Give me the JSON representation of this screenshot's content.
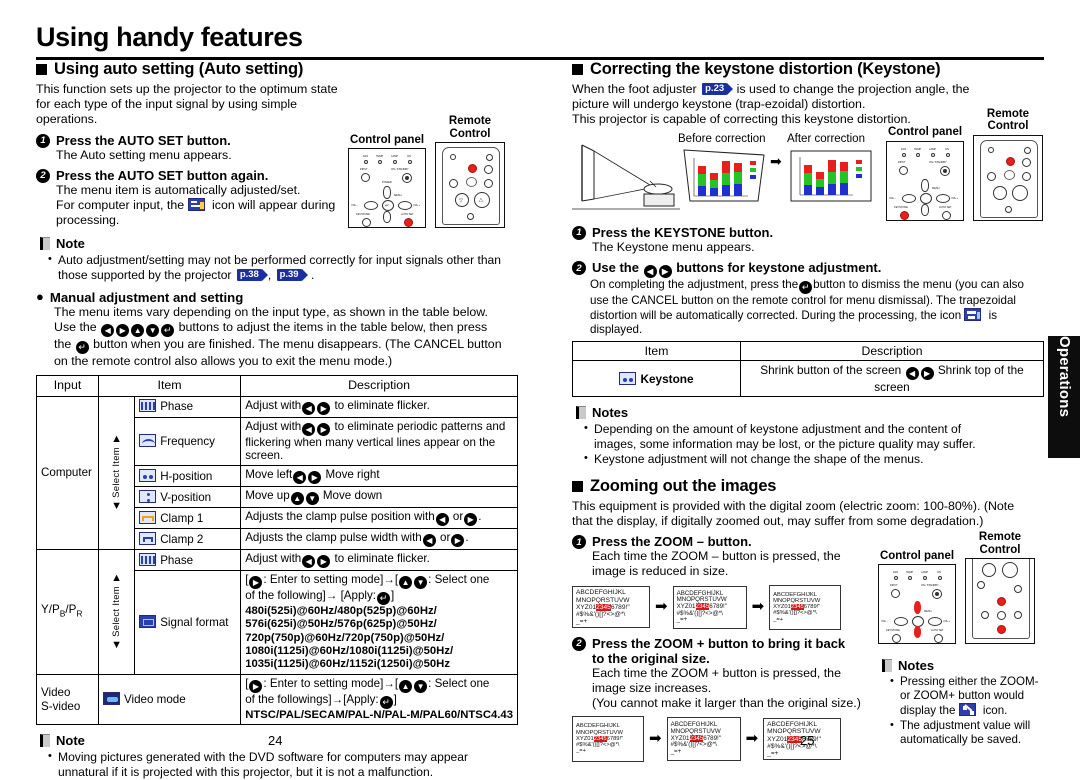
{
  "chapter": {
    "title": "Using handy features"
  },
  "page_numbers": {
    "left": "24",
    "right": "25"
  },
  "side_tab": {
    "label": "Operations"
  },
  "auto_setting": {
    "heading": "Using auto setting (Auto setting)",
    "intro": "This function sets up the projector to the optimum state for each type of the input signal by using simple operations.",
    "step1_title": "Press the AUTO SET button.",
    "step1_sub": "The Auto setting menu appears.",
    "step2_title": "Press the AUTO SET button again.",
    "step2_sub_a": "The menu item is automatically adjusted/set.",
    "step2_sub_b1": "For computer input, the",
    "step2_sub_b2": "icon will appear during",
    "step2_sub_c": "processing.",
    "note_heading": "Note",
    "note_text_a": "Auto adjustment/setting may not be performed correctly for input signals other than those supported by the projector",
    "note_ref1": "p.38",
    "note_ref2": "p.39",
    "devices": {
      "control_panel": "Control panel",
      "remote_l1": "Remote",
      "remote_l2": "Control"
    }
  },
  "manual": {
    "bullet_heading": "Manual adjustment and setting",
    "line1": "The menu items vary depending on the input type, as shown in the table below.",
    "line2_a": "Use the",
    "line2_b": "buttons to adjust the items in the table below, then press",
    "line3_a": "the",
    "line3_b": "button when you are finished. The menu disappears. (The CANCEL button",
    "line4": "on the remote control also allows you to exit the menu mode.)"
  },
  "menu_table": {
    "headers": [
      "Input",
      "Item",
      "Description"
    ],
    "select_item_label": "Select Item",
    "groups": [
      {
        "input": "Computer",
        "rows": [
          {
            "icon": "phase-icon",
            "item": "Phase",
            "desc_pre": "Adjust with",
            "desc_post": "to eliminate flicker.",
            "btns": [
              "left",
              "right"
            ]
          },
          {
            "icon": "frequency-icon",
            "item": "Frequency",
            "desc_pre": "Adjust with",
            "desc_post": "to eliminate periodic patterns and flickering when many vertical lines appear on the screen.",
            "btns": [
              "left",
              "right"
            ]
          },
          {
            "icon": "hposition-icon",
            "item": "H-position",
            "desc_pre": "Move left",
            "desc_post": "Move right",
            "btns": [
              "left",
              "right"
            ]
          },
          {
            "icon": "vposition-icon",
            "item": "V-position",
            "desc_pre": "Move up",
            "desc_post": "Move down",
            "btns": [
              "up",
              "down"
            ]
          },
          {
            "icon": "clamp1-icon",
            "item": "Clamp 1",
            "desc_pre": "Adjusts the clamp pulse position with",
            "desc_mid": "or",
            "desc_post": ".",
            "btns": [
              "left",
              "right"
            ]
          },
          {
            "icon": "clamp2-icon",
            "item": "Clamp 2",
            "desc_pre": "Adjusts the clamp pulse width with",
            "desc_mid": "or",
            "desc_post": ".",
            "btns": [
              "left",
              "right"
            ]
          }
        ]
      },
      {
        "input": "Y/PB/PR",
        "rows": [
          {
            "icon": "phase-icon",
            "item": "Phase",
            "desc_pre": "Adjust with",
            "desc_post": "to eliminate flicker.",
            "btns": [
              "left",
              "right"
            ]
          },
          {
            "icon": "signal-icon",
            "item": "Signal format",
            "mode_a": ": Enter to setting mode]",
            "mode_b": ": Select one",
            "mode_c": "of the following]",
            "mode_d": "[Apply:",
            "formats": [
              "480i(525i)@60Hz/480p(525p)@60Hz/",
              "576i(625i)@50Hz/576p(625p)@50Hz/",
              "720p(750p)@60Hz/720p(750p)@50Hz/",
              "1080i(1125i)@60Hz/1080i(1125i)@50Hz/",
              "1035i(1125i)@60Hz/1152i(1250i)@50Hz"
            ]
          }
        ]
      },
      {
        "input": "Video\nS-video",
        "input_l1": "Video",
        "input_l2": "S-video",
        "rows": [
          {
            "icon": "videomode-icon",
            "item": "Video mode",
            "mode_a": ": Enter to setting mode]",
            "mode_b": ": Select one",
            "mode_c": "of the followings]",
            "mode_d": "[Apply:",
            "formats": [
              "NTSC/PAL/SECAM/PAL-N/PAL-M/PAL60/NTSC4.43"
            ]
          }
        ]
      }
    ]
  },
  "dvd_note": {
    "heading": "Note",
    "text": "Moving pictures generated with the DVD software for computers may appear unnatural if it is projected with this projector, but it is not a malfunction."
  },
  "keystone": {
    "heading": "Correcting the keystone distortion (Keystone)",
    "intro_a": "When the foot adjuster",
    "intro_ref": "p.23",
    "intro_b": "is used to change the projection angle, the picture will undergo keystone (trap-ezoidal) distortion.",
    "intro_c": "This projector is capable of correcting this keystone distortion.",
    "before_label": "Before correction",
    "after_label": "After correction",
    "step1_title": "Press the KEYSTONE button.",
    "step1_sub": "The Keystone menu appears.",
    "step2_title_a": "Use the",
    "step2_title_b": "buttons for keystone adjustment.",
    "step2_sub_a": "On completing the adjustment, press the",
    "step2_sub_b": "button to dismiss the menu (you can also use the",
    "step2_sub_c": "CANCEL button on the remote control for menu dismissal). The trapezoidal distortion will be",
    "step2_sub_d": "automatically corrected. During the processing, the icon",
    "step2_sub_e": "is displayed.",
    "table": {
      "headers": [
        "Item",
        "Description"
      ],
      "row_item": "Keystone",
      "row_desc_pre": "Shrink button of the screen",
      "row_desc_post": "Shrink top of the screen"
    },
    "notes_heading": "Notes",
    "note1": "Depending on the amount of keystone adjustment and the content of images, some information may be lost, or the picture quality may suffer.",
    "note2": "Keystone adjustment will not change the shape of the menus.",
    "devices": {
      "control_panel": "Control panel",
      "remote_l1": "Remote",
      "remote_l2": "Control"
    }
  },
  "zooming": {
    "heading": "Zooming out the images",
    "intro": "This equipment is provided with the digital zoom (electric zoom: 100-80%). (Note that the display, if digitally zoomed out, may suffer from some degradation.)",
    "step1_title": "Press the ZOOM – button.",
    "step1_sub": "Each time the ZOOM – button is pressed, the image is reduced in size.",
    "step2_title_l1": "Press the ZOOM + button to bring it back",
    "step2_title_l2": "to the original size.",
    "step2_sub_a": "Each time the ZOOM + button is pressed, the",
    "step2_sub_b": "image size increases.",
    "step2_sub_c": "(You cannot make it larger than the original size.)",
    "sample_lines": [
      "ABCDEFGHIJKL",
      "MNOPQRSTUVW",
      "XYZ01",
      "23456",
      "789!\"",
      "#$%&'()[]?<>@*\\",
      "_=+"
    ],
    "sample": {
      "l1": "ABCDEFGHIJKL",
      "l2": "MNOPQRSTUVW",
      "l3a": "XYZ01",
      "l3b": "2345",
      "l3c": "6789!\"",
      "l4": "#$%&'()[]?<>@*\\",
      "l5": "_=+"
    },
    "notes_heading": "Notes",
    "note1_a": "Pressing either the ZOOM-",
    "note1_b": "or ZOOM+ button would",
    "note1_c": "display the",
    "note1_d": "icon.",
    "note2_a": "The adjustment value will",
    "note2_b": "automatically be saved.",
    "devices": {
      "control_panel": "Control panel",
      "remote_l1": "Remote",
      "remote_l2": "Control"
    }
  },
  "glyphs": {
    "left": "◀",
    "right": "▶",
    "up": "▲",
    "down": "▼",
    "enter": "↵",
    "arrow": "➡"
  },
  "panel_labels": {
    "fan": "FAN",
    "temp": "TEMP",
    "lamp": "LAMP",
    "on": "ON",
    "input": "INPUT",
    "standby": "ON / STANDBY",
    "menu": "MENU",
    "power": "POWER",
    "vol_minus": "VOL.-",
    "vol_plus": "VOL.+",
    "keystone": "KEYSTONE",
    "autoset": "AUTO SET",
    "fine": "FINE"
  },
  "colors": {
    "ref_badge": "#1b2f9e",
    "highlight": "#d2191a",
    "button_red": "#e8201b",
    "tab_bg": "#0d0d0d",
    "icon_blue": "#2b3fae"
  }
}
